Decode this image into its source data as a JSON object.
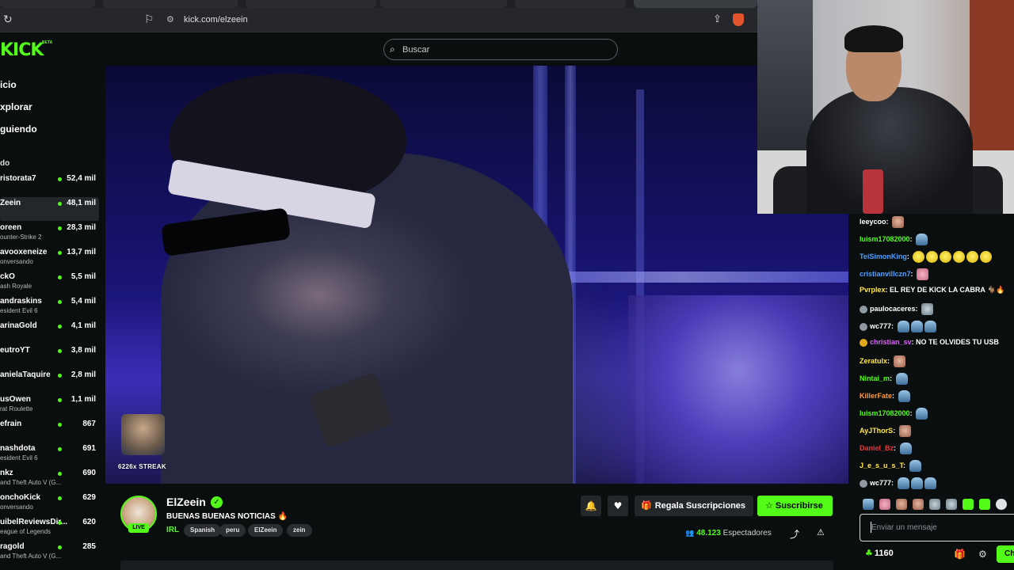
{
  "browser": {
    "url": "kick.com/elzeein",
    "reload_icon": "↻",
    "bookmark_icon": "⚐",
    "site_icon": "⚙",
    "share_icon": "⇪"
  },
  "header": {
    "logo": "KICK",
    "logo_badge": "BETA",
    "search_icon": "⌕",
    "search_placeholder": "Buscar"
  },
  "sidebar": {
    "nav": [
      "icio",
      "xplorar",
      "guiendo"
    ],
    "section_label": "do",
    "channels": [
      {
        "name": "ristorata7",
        "category": "",
        "viewers": "52,4 mil"
      },
      {
        "name": "Zeein",
        "category": "",
        "viewers": "48,1 mil",
        "active": true
      },
      {
        "name": "oreen",
        "category": "ounter-Strike 2",
        "viewers": "28,3 mil"
      },
      {
        "name": "avooxeneize",
        "category": "onversando",
        "viewers": "13,7 mil"
      },
      {
        "name": "ckO",
        "category": "ash Royale",
        "viewers": "5,5 mil"
      },
      {
        "name": "andraskins",
        "category": "esident Evil 6",
        "viewers": "5,4 mil"
      },
      {
        "name": "arinaGold",
        "category": "",
        "viewers": "4,1 mil"
      },
      {
        "name": "eutroYT",
        "category": "",
        "viewers": "3,8 mil"
      },
      {
        "name": "anielaTaquire",
        "category": "",
        "viewers": "2,8 mil"
      },
      {
        "name": "usOwen",
        "category": "rat Roulette",
        "viewers": "1,1 mil"
      },
      {
        "name": "efrain",
        "category": "",
        "viewers": "867"
      },
      {
        "name": "nashdota",
        "category": "esident Evil 6",
        "viewers": "691"
      },
      {
        "name": "nkz",
        "category": "and Theft Auto V (G...",
        "viewers": "690"
      },
      {
        "name": "onchoKick",
        "category": "onversando",
        "viewers": "629"
      },
      {
        "name": "uibelReviewsDir...",
        "category": "eague of Legends",
        "viewers": "620"
      },
      {
        "name": "ragold",
        "category": "and Theft Auto V (G...",
        "viewers": "285"
      }
    ]
  },
  "video": {
    "streak_label": "6226x STREAK"
  },
  "stream": {
    "streamer": "ElZeein",
    "verified_icon": "✓",
    "live": "LIVE",
    "title": "BUENAS BUENAS NOTICIAS 🔥",
    "category": "IRL",
    "tags": [
      "Spanish",
      "peru",
      "ElZeein",
      "zein"
    ],
    "bell_icon": "🔔",
    "heart_icon": "♥",
    "gift_icon": "🎁",
    "gift_label": "Regala Suscripciones",
    "sub_icon": "☆",
    "subscribe_label": "Suscribirse",
    "viewers_icon": "👥",
    "viewers_count": "48.123",
    "viewers_label": "Espectadores",
    "share_icon": "⤴",
    "report_icon": "⚠"
  },
  "chat": {
    "messages": [
      {
        "user": "leeycoo",
        "color": "#ffffff",
        "text": "",
        "emotes": [
          "e-face"
        ],
        "badge": ""
      },
      {
        "user": "luism17082000",
        "color": "#53fc18",
        "text": "",
        "emotes": [
          "e-blue"
        ],
        "badge": ""
      },
      {
        "user": "TeiSimonKing",
        "color": "#4fa0ff",
        "text": "",
        "emotes": [
          "e-yellow",
          "e-yellow",
          "e-yellow",
          "e-yellow",
          "e-yellow",
          "e-yellow"
        ],
        "badge": ""
      },
      {
        "user": "cristianvillczn7",
        "color": "#4fa0ff",
        "text": "",
        "emotes": [
          "e-pink"
        ],
        "badge": ""
      },
      {
        "user": "Pvrplex",
        "color": "#ffe94a",
        "text": "EL REY DE KICK LA CABRA 🐐🔥",
        "emotes": [],
        "badge": ""
      },
      {
        "user": "paulocaceres",
        "color": "#ffffff",
        "text": "",
        "emotes": [
          "e-gray"
        ],
        "badge": "b-gray"
      },
      {
        "user": "wc777",
        "color": "#ffffff",
        "text": "",
        "emotes": [
          "e-blue",
          "e-blue",
          "e-blue"
        ],
        "badge": "b-gray"
      },
      {
        "user": "christian_sv",
        "color": "#e060ff",
        "text": "NO TE OLVIDES TU USB",
        "emotes": [],
        "badge": "b-gold"
      },
      {
        "user": "Zeratulx",
        "color": "#ffe94a",
        "text": "",
        "emotes": [
          "e-face"
        ],
        "badge": ""
      },
      {
        "user": "Nintai_m",
        "color": "#53fc18",
        "text": "",
        "emotes": [
          "e-blue"
        ],
        "badge": ""
      },
      {
        "user": "KillerFate",
        "color": "#ff9a3c",
        "text": "",
        "emotes": [
          "e-blue"
        ],
        "badge": ""
      },
      {
        "user": "luism17082000",
        "color": "#53fc18",
        "text": "",
        "emotes": [
          "e-blue"
        ],
        "badge": ""
      },
      {
        "user": "AyJThorS",
        "color": "#ffe94a",
        "text": "",
        "emotes": [
          "e-face"
        ],
        "badge": ""
      },
      {
        "user": "Daniel_Bz",
        "color": "#e33b3b",
        "text": "",
        "emotes": [
          "e-blue"
        ],
        "badge": ""
      },
      {
        "user": "J_e_s_u_s_T",
        "color": "#ffe94a",
        "text": "",
        "emotes": [
          "e-blue"
        ],
        "badge": ""
      },
      {
        "user": "wc777",
        "color": "#ffffff",
        "text": "",
        "emotes": [
          "e-blue",
          "e-blue",
          "e-blue"
        ],
        "badge": "b-gray"
      }
    ],
    "input_placeholder": "Enviar un mensaje",
    "points_icon": "♣",
    "points": "1160",
    "gift_icon": "🎁",
    "settings_icon": "⚙",
    "send_label": "Ch"
  }
}
